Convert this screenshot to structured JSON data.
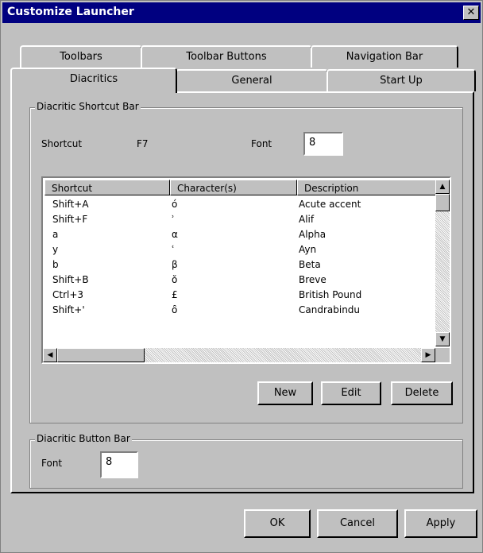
{
  "window": {
    "title": "Customize Launcher",
    "close_glyph": "✕"
  },
  "tabs": {
    "back_row": [
      "Toolbars",
      "Toolbar Buttons",
      "Navigation Bar"
    ],
    "front_row": [
      "Diacritics",
      "General",
      "Start Up"
    ],
    "active": "Diacritics"
  },
  "shortcut_bar": {
    "legend": "Diacritic Shortcut Bar",
    "shortcut_label": "Shortcut",
    "shortcut_value": "F7",
    "font_label": "Font",
    "font_value": "8"
  },
  "table": {
    "columns": [
      "Shortcut",
      "Character(s)",
      "Description"
    ],
    "rows": [
      [
        "Shift+A",
        "ó",
        "Acute accent"
      ],
      [
        "Shift+F",
        "ʾ",
        "Alif"
      ],
      [
        "a",
        "α",
        "Alpha"
      ],
      [
        "y",
        "ʿ",
        "Ayn"
      ],
      [
        "b",
        "β",
        "Beta"
      ],
      [
        "Shift+B",
        "ŏ",
        "Breve"
      ],
      [
        "Ctrl+3",
        "£",
        "British Pound"
      ],
      [
        "Shift+'",
        "ȏ",
        "Candrabindu"
      ]
    ]
  },
  "actions": {
    "new": "New",
    "edit": "Edit",
    "delete": "Delete"
  },
  "button_bar": {
    "legend": "Diacritic Button Bar",
    "font_label": "Font",
    "font_value": "8"
  },
  "footer": {
    "ok": "OK",
    "cancel": "Cancel",
    "apply": "Apply"
  }
}
